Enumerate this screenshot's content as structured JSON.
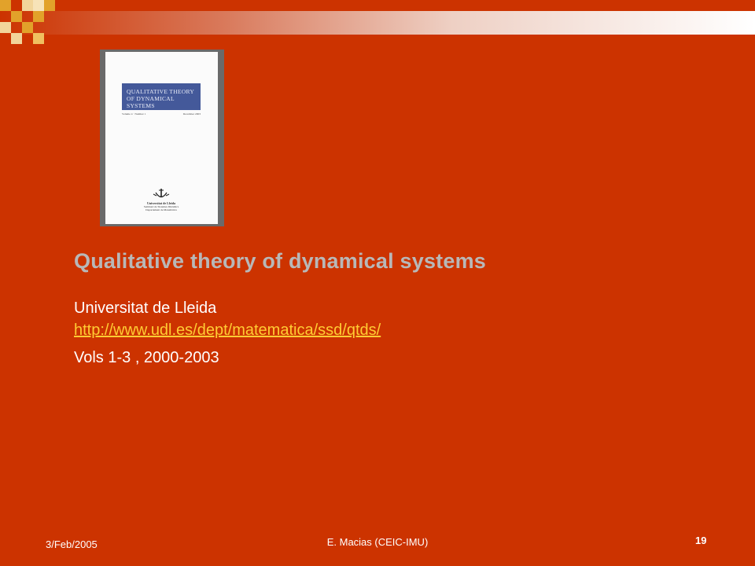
{
  "colors": {
    "background": "#cc3300",
    "title_text": "#b8b8b8",
    "link_text": "#ffcc33",
    "body_text": "#ffffff",
    "cover_band": "#44599a",
    "accent_square_dark": "#cc3300",
    "accent_square_light": "#e2a22a"
  },
  "cover": {
    "title_line1": "QUALITATIVE THEORY",
    "title_line2": "OF DYNAMICAL SYSTEMS",
    "volume": "Volume 4 · Number 1",
    "date": "December 2003",
    "publisher_name": "Universitat de Lleida",
    "publisher_line2": "Seminari de Sistemes Dinàmics",
    "publisher_line3": "Departament de Matemàtica",
    "logo": "university-logo-icon"
  },
  "slide": {
    "title": "Qualitative theory of dynamical systems",
    "line1": "Universitat de Lleida",
    "link": "http://www.udl.es/dept/matematica/ssd/qtds/",
    "line3": "Vols 1-3 , 2000-2003"
  },
  "footer": {
    "date": "3/Feb/2005",
    "author": "E. Macias (CEIC-IMU)",
    "page": "19"
  }
}
